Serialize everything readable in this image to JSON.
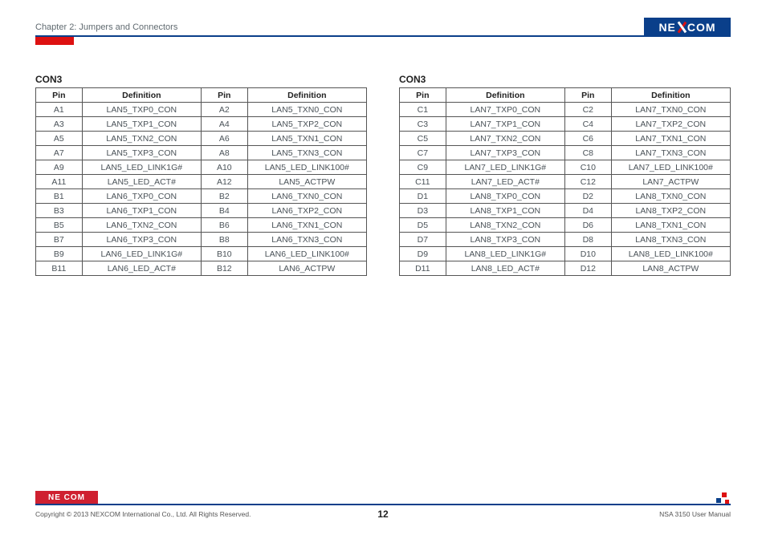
{
  "header": {
    "chapter": "Chapter 2: Jumpers and Connectors",
    "logo_text_pre": "NE",
    "logo_text_post": "COM"
  },
  "tables": {
    "left": {
      "title": "CON3",
      "headers": {
        "pin": "Pin",
        "def": "Definition"
      },
      "rows": [
        {
          "p1": "A1",
          "d1": "LAN5_TXP0_CON",
          "p2": "A2",
          "d2": "LAN5_TXN0_CON"
        },
        {
          "p1": "A3",
          "d1": "LAN5_TXP1_CON",
          "p2": "A4",
          "d2": "LAN5_TXP2_CON"
        },
        {
          "p1": "A5",
          "d1": "LAN5_TXN2_CON",
          "p2": "A6",
          "d2": "LAN5_TXN1_CON"
        },
        {
          "p1": "A7",
          "d1": "LAN5_TXP3_CON",
          "p2": "A8",
          "d2": "LAN5_TXN3_CON"
        },
        {
          "p1": "A9",
          "d1": "LAN5_LED_LINK1G#",
          "p2": "A10",
          "d2": "LAN5_LED_LINK100#"
        },
        {
          "p1": "A11",
          "d1": "LAN5_LED_ACT#",
          "p2": "A12",
          "d2": "LAN5_ACTPW"
        },
        {
          "p1": "B1",
          "d1": "LAN6_TXP0_CON",
          "p2": "B2",
          "d2": "LAN6_TXN0_CON"
        },
        {
          "p1": "B3",
          "d1": "LAN6_TXP1_CON",
          "p2": "B4",
          "d2": "LAN6_TXP2_CON"
        },
        {
          "p1": "B5",
          "d1": "LAN6_TXN2_CON",
          "p2": "B6",
          "d2": "LAN6_TXN1_CON"
        },
        {
          "p1": "B7",
          "d1": "LAN6_TXP3_CON",
          "p2": "B8",
          "d2": "LAN6_TXN3_CON"
        },
        {
          "p1": "B9",
          "d1": "LAN6_LED_LINK1G#",
          "p2": "B10",
          "d2": "LAN6_LED_LINK100#"
        },
        {
          "p1": "B11",
          "d1": "LAN6_LED_ACT#",
          "p2": "B12",
          "d2": "LAN6_ACTPW"
        }
      ]
    },
    "right": {
      "title": "CON3",
      "headers": {
        "pin": "Pin",
        "def": "Definition"
      },
      "rows": [
        {
          "p1": "C1",
          "d1": "LAN7_TXP0_CON",
          "p2": "C2",
          "d2": "LAN7_TXN0_CON"
        },
        {
          "p1": "C3",
          "d1": "LAN7_TXP1_CON",
          "p2": "C4",
          "d2": "LAN7_TXP2_CON"
        },
        {
          "p1": "C5",
          "d1": "LAN7_TXN2_CON",
          "p2": "C6",
          "d2": "LAN7_TXN1_CON"
        },
        {
          "p1": "C7",
          "d1": "LAN7_TXP3_CON",
          "p2": "C8",
          "d2": "LAN7_TXN3_CON"
        },
        {
          "p1": "C9",
          "d1": "LAN7_LED_LINK1G#",
          "p2": "C10",
          "d2": "LAN7_LED_LINK100#"
        },
        {
          "p1": "C11",
          "d1": "LAN7_LED_ACT#",
          "p2": "C12",
          "d2": "LAN7_ACTPW"
        },
        {
          "p1": "D1",
          "d1": "LAN8_TXP0_CON",
          "p2": "D2",
          "d2": "LAN8_TXN0_CON"
        },
        {
          "p1": "D3",
          "d1": "LAN8_TXP1_CON",
          "p2": "D4",
          "d2": "LAN8_TXP2_CON"
        },
        {
          "p1": "D5",
          "d1": "LAN8_TXN2_CON",
          "p2": "D6",
          "d2": "LAN8_TXN1_CON"
        },
        {
          "p1": "D7",
          "d1": "LAN8_TXP3_CON",
          "p2": "D8",
          "d2": "LAN8_TXN3_CON"
        },
        {
          "p1": "D9",
          "d1": "LAN8_LED_LINK1G#",
          "p2": "D10",
          "d2": "LAN8_LED_LINK100#"
        },
        {
          "p1": "D11",
          "d1": "LAN8_LED_ACT#",
          "p2": "D12",
          "d2": "LAN8_ACTPW"
        }
      ]
    }
  },
  "footer": {
    "logo_text": "NE COM",
    "copyright": "Copyright © 2013 NEXCOM International Co., Ltd. All Rights Reserved.",
    "page": "12",
    "manual": "NSA 3150 User Manual"
  }
}
